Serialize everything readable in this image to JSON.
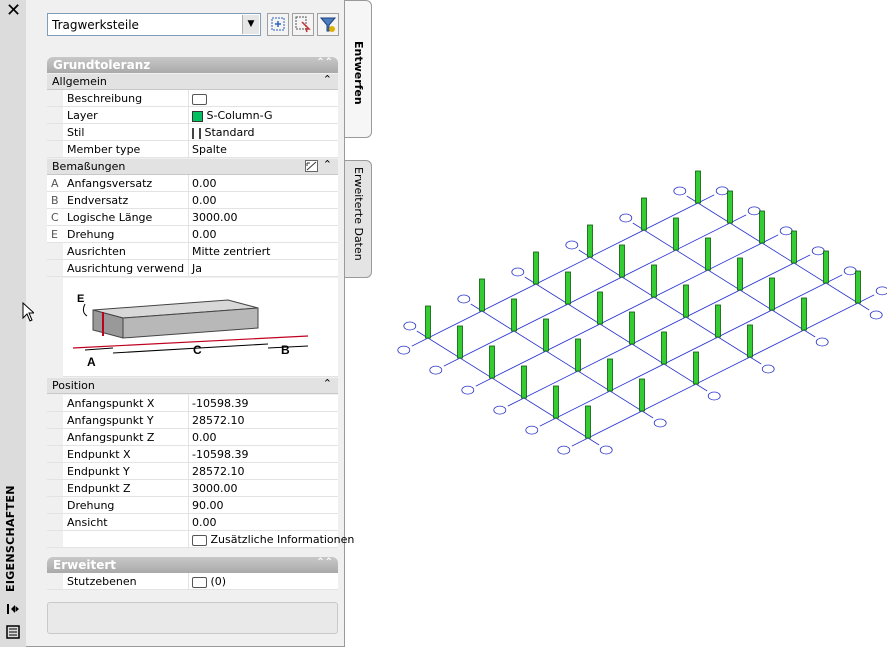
{
  "palette": {
    "side_title": "EIGENSCHAFTEN",
    "close_glyph": "✕",
    "dropdown_value": "Tragwerksteile",
    "tabs": [
      "Entwerfen",
      "Erweiterte Daten"
    ]
  },
  "sections": {
    "grundtoleranz": "Grundtoleranz",
    "erweitert": "Erweitert"
  },
  "allgemein": {
    "title": "Allgemein",
    "rows": [
      {
        "label": "Beschreibung",
        "value": ""
      },
      {
        "label": "Layer",
        "value": "S-Column-G"
      },
      {
        "label": "Stil",
        "value": "Standard"
      },
      {
        "label": "Member type",
        "value": "Spalte"
      }
    ]
  },
  "bemassungen": {
    "title": "Bemaßungen",
    "rows": [
      {
        "letter": "A",
        "label": "Anfangsversatz",
        "value": "0.00"
      },
      {
        "letter": "B",
        "label": "Endversatz",
        "value": "0.00"
      },
      {
        "letter": "C",
        "label": "Logische Länge",
        "value": "3000.00"
      },
      {
        "letter": "E",
        "label": "Drehung",
        "value": "0.00"
      },
      {
        "letter": "",
        "label": "Ausrichten",
        "value": "Mitte zentriert"
      },
      {
        "letter": "",
        "label": "Ausrichtung verwend ...",
        "value": "Ja"
      }
    ],
    "diagram_labels": {
      "a": "A",
      "b": "B",
      "c": "C",
      "e": "E"
    }
  },
  "position": {
    "title": "Position",
    "rows": [
      {
        "label": "Anfangspunkt X",
        "value": "-10598.39"
      },
      {
        "label": "Anfangspunkt Y",
        "value": "28572.10"
      },
      {
        "label": "Anfangspunkt Z",
        "value": "0.00"
      },
      {
        "label": "Endpunkt X",
        "value": "-10598.39"
      },
      {
        "label": "Endpunkt Y",
        "value": "28572.10"
      },
      {
        "label": "Endpunkt Z",
        "value": "3000.00"
      },
      {
        "label": "Drehung",
        "value": "90.00"
      },
      {
        "label": "Ansicht",
        "value": "0.00"
      }
    ],
    "extra_info": "Zusätzliche Informationen"
  },
  "erweitert": {
    "rows": [
      {
        "label": "Stutzebenen",
        "value": "(0)"
      }
    ]
  },
  "colors": {
    "column_green": "#33cc33",
    "grid_blue": "#2a35c8",
    "section_header": "#b0b0b0"
  }
}
